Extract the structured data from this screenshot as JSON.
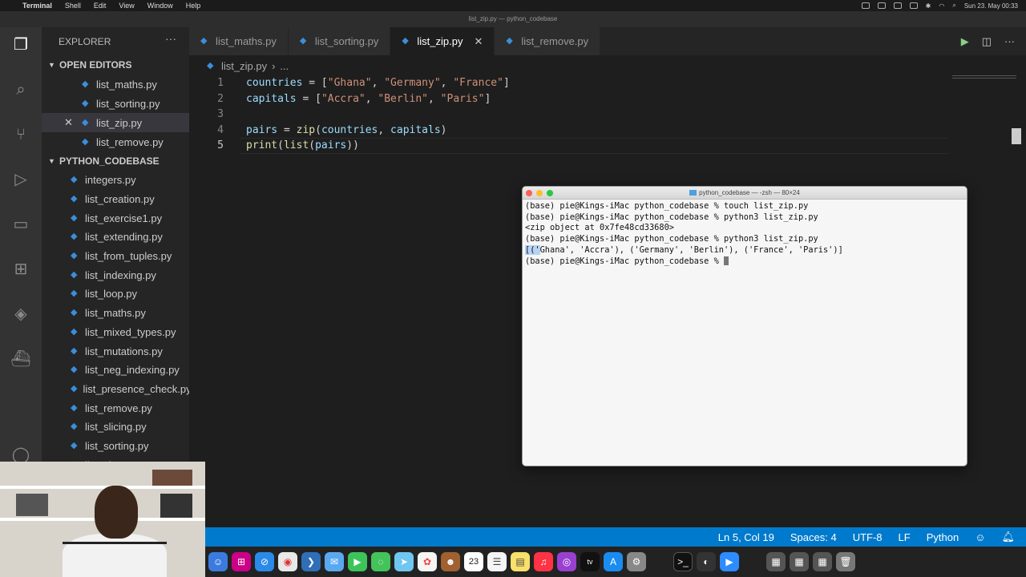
{
  "menubar": {
    "app": "Terminal",
    "items": [
      "Shell",
      "Edit",
      "View",
      "Window",
      "Help"
    ],
    "clock": "Sun 23. May 00:33"
  },
  "window_title": "list_zip.py — python_codebase",
  "sidebar": {
    "header": "EXPLORER",
    "open_editors_title": "OPEN EDITORS",
    "open_editors": [
      "list_maths.py",
      "list_sorting.py",
      "list_zip.py",
      "list_remove.py"
    ],
    "project_title": "PYTHON_CODEBASE",
    "files": [
      "integers.py",
      "list_creation.py",
      "list_exercise1.py",
      "list_extending.py",
      "list_from_tuples.py",
      "list_indexing.py",
      "list_loop.py",
      "list_maths.py",
      "list_mixed_types.py",
      "list_mutations.py",
      "list_neg_indexing.py",
      "list_presence_check.py",
      "list_remove.py",
      "list_slicing.py",
      "list_sorting.py",
      "list_zip.py"
    ]
  },
  "tabs": [
    "list_maths.py",
    "list_sorting.py",
    "list_zip.py",
    "list_remove.py"
  ],
  "breadcrumb": {
    "file": "list_zip.py",
    "rest": "..."
  },
  "editor": {
    "line_numbers": [
      "1",
      "2",
      "3",
      "4",
      "5"
    ],
    "lines": [
      "countries = [\"Ghana\", \"Germany\", \"France\"]",
      "capitals = [\"Accra\", \"Berlin\", \"Paris\"]",
      "",
      "pairs = zip(countries, capitals)",
      "print(list(pairs))"
    ]
  },
  "terminal": {
    "title": "python_codebase — -zsh — 80×24",
    "lines": [
      "(base) pie@Kings-iMac python_codebase % touch list_zip.py",
      "(base) pie@Kings-iMac python_codebase % python3 list_zip.py",
      "<zip object at 0x7fe48cd33680>",
      "(base) pie@Kings-iMac python_codebase % python3 list_zip.py",
      "[('Ghana', 'Accra'), ('Germany', 'Berlin'), ('France', 'Paris')]",
      "(base) pie@Kings-iMac python_codebase % "
    ]
  },
  "status": {
    "position": "Ln 5, Col 19",
    "spaces": "Spaces: 4",
    "encoding": "UTF-8",
    "eol": "LF",
    "language": "Python"
  },
  "dock": {
    "calendar_day": "23"
  }
}
